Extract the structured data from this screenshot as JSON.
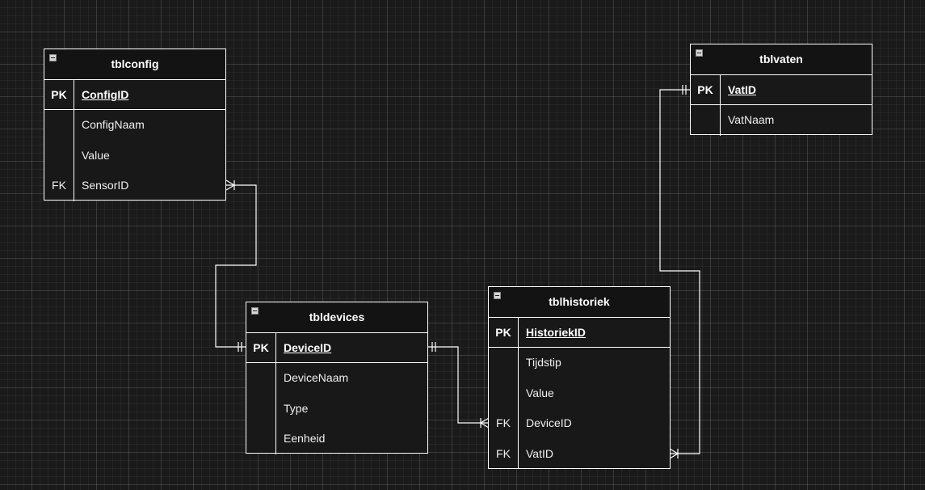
{
  "diagram": {
    "entities": [
      {
        "id": "tblconfig",
        "title": "tblconfig",
        "rows": [
          {
            "key": "PK",
            "field": "ConfigID",
            "primary": true
          },
          {
            "key": "",
            "field": "ConfigNaam"
          },
          {
            "key": "",
            "field": "Value"
          },
          {
            "key": "FK",
            "field": "SensorID"
          }
        ]
      },
      {
        "id": "tblvaten",
        "title": "tblvaten",
        "rows": [
          {
            "key": "PK",
            "field": "VatID",
            "primary": true
          },
          {
            "key": "",
            "field": "VatNaam"
          }
        ]
      },
      {
        "id": "tbldevices",
        "title": "tbldevices",
        "rows": [
          {
            "key": "PK",
            "field": "DeviceID",
            "primary": true
          },
          {
            "key": "",
            "field": "DeviceNaam"
          },
          {
            "key": "",
            "field": "Type"
          },
          {
            "key": "",
            "field": "Eenheid"
          }
        ]
      },
      {
        "id": "tblhistoriek",
        "title": "tblhistoriek",
        "rows": [
          {
            "key": "PK",
            "field": "HistoriekID",
            "primary": true
          },
          {
            "key": "",
            "field": "Tijdstip"
          },
          {
            "key": "",
            "field": "Value"
          },
          {
            "key": "FK",
            "field": "DeviceID"
          },
          {
            "key": "FK",
            "field": "VatID"
          }
        ]
      }
    ],
    "relationships": [
      {
        "from": "tbldevices.DeviceID",
        "from_cardinality": "one",
        "to": "tblconfig.SensorID",
        "to_cardinality": "many"
      },
      {
        "from": "tbldevices.DeviceID",
        "from_cardinality": "one",
        "to": "tblhistoriek.DeviceID",
        "to_cardinality": "many"
      },
      {
        "from": "tblvaten.VatID",
        "from_cardinality": "one",
        "to": "tblhistoriek.VatID",
        "to_cardinality": "many"
      }
    ],
    "colors": {
      "background": "#1a1a1a",
      "stroke": "#ffffff",
      "text": "#ffffff"
    },
    "icons": {
      "collapse": "collapse-icon"
    }
  }
}
